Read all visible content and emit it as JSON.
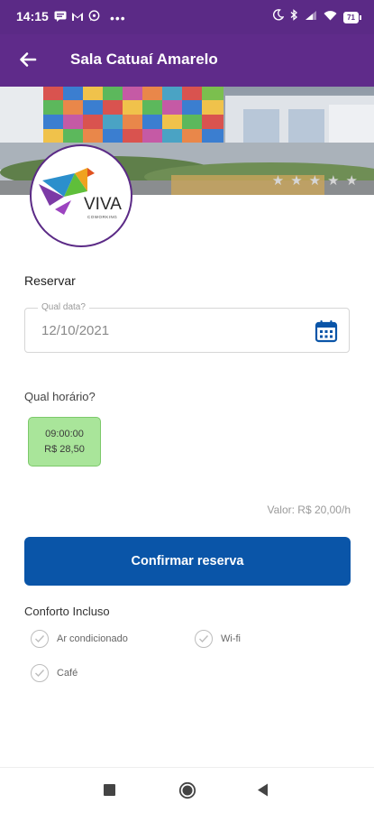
{
  "status_bar": {
    "time": "14:15",
    "notification_icons": [
      "message-icon",
      "gmail-icon",
      "whatsapp-icon",
      "more-icon"
    ],
    "system_icons": [
      "moon-icon",
      "bluetooth-icon",
      "signal-icon",
      "wifi-icon"
    ],
    "battery": "71"
  },
  "app_bar": {
    "back_icon": "arrow-left-icon",
    "title": "Sala Catuaí Amarelo"
  },
  "venue": {
    "logo_text": "VIVA",
    "logo_subtext": "COWORKING",
    "rating_stars": 5
  },
  "booking": {
    "section_title": "Reservar",
    "date_label": "Qual data?",
    "date_value": "12/10/2021",
    "time_question": "Qual horário?",
    "slots": [
      {
        "time": "09:00:00",
        "price": "R$ 28,50",
        "selected": true
      }
    ],
    "hourly_price": "Valor: R$ 20,00/h",
    "confirm_label": "Confirmar reserva"
  },
  "comfort": {
    "title": "Conforto Incluso",
    "items": [
      "Ar condicionado",
      "Wi-fi",
      "Café"
    ]
  },
  "nav_bar": {
    "buttons": [
      "recents-square-icon",
      "home-circle-icon",
      "back-triangle-icon"
    ]
  },
  "colors": {
    "purple": "#5f2b8a",
    "blue_button": "#0a55a8",
    "slot_green": "#a9e59a"
  }
}
